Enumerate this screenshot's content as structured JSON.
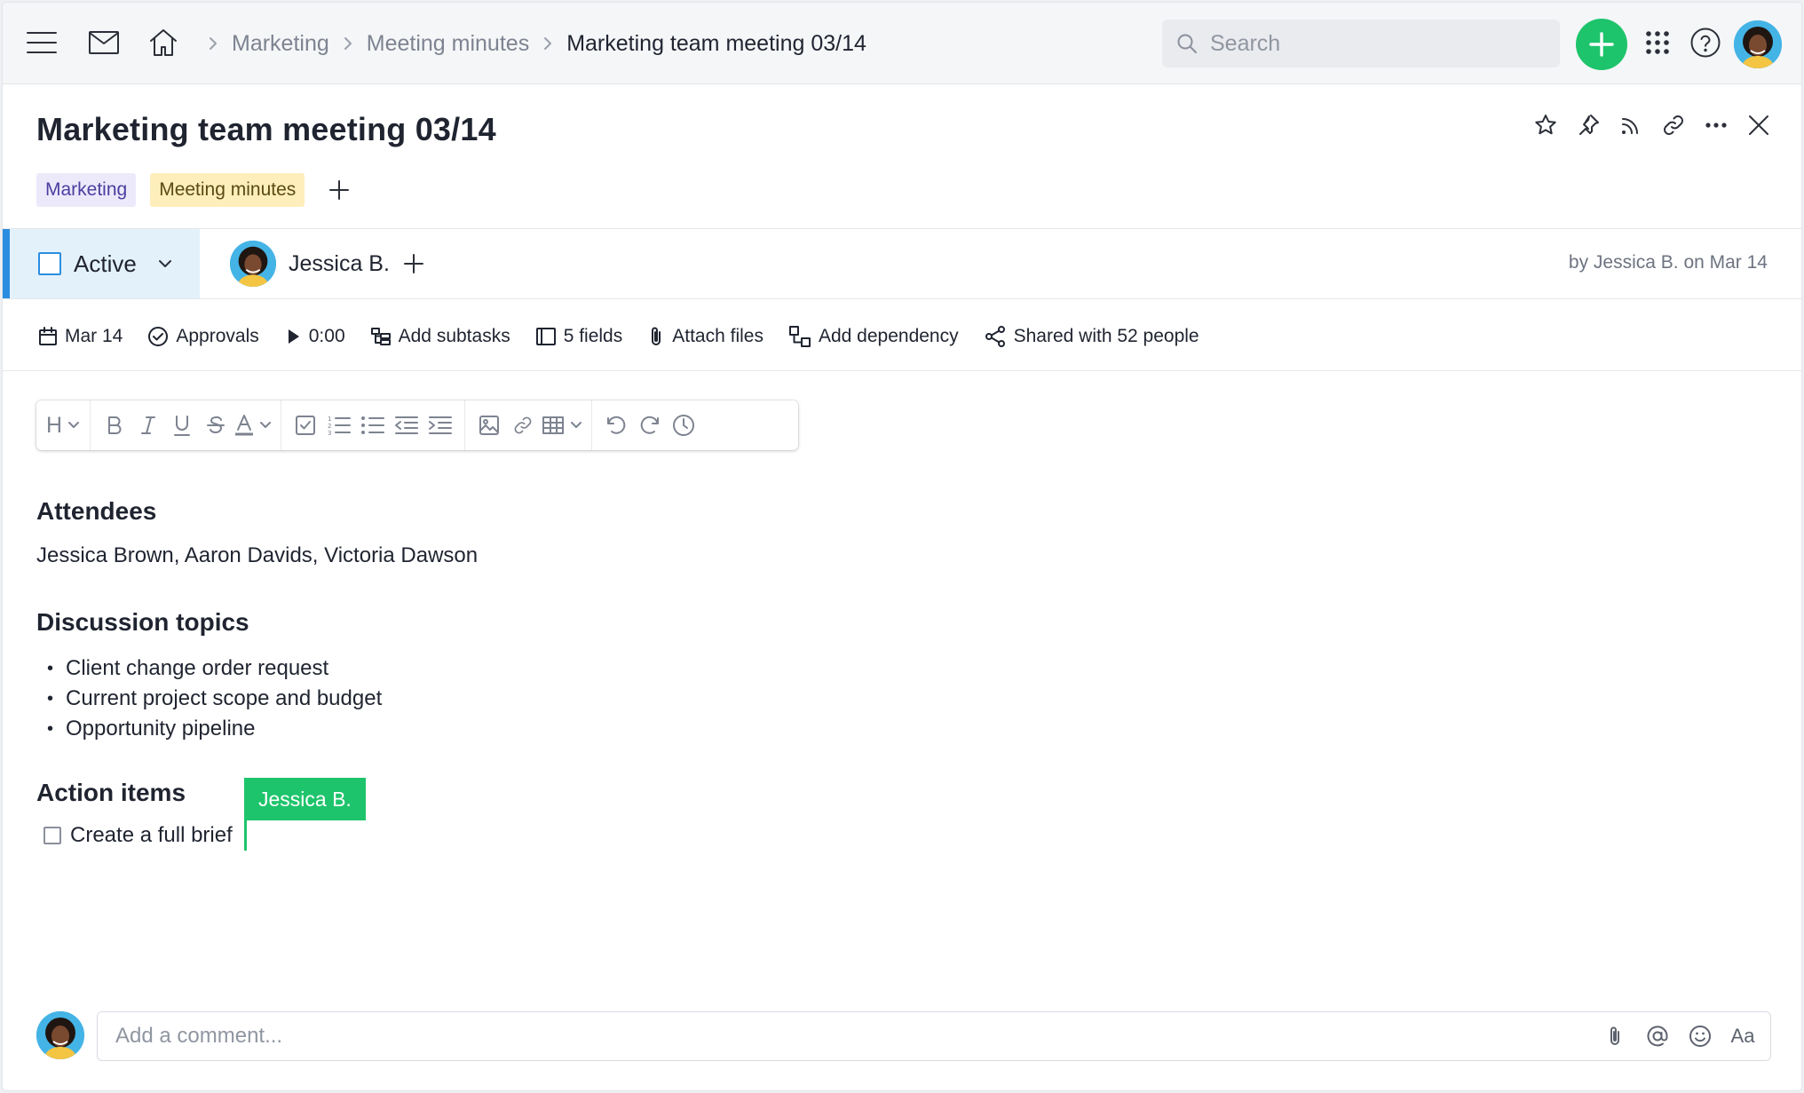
{
  "topbar": {
    "menu_icon": "hamburger-icon",
    "inbox_icon": "mail-icon",
    "home_icon": "home-icon",
    "breadcrumbs": [
      "Marketing",
      "Meeting minutes",
      "Marketing team meeting 03/14"
    ],
    "search_placeholder": "Search",
    "add_button_icon": "plus-icon",
    "apps_icon": "grid-icon",
    "help_icon": "help-icon",
    "brand_color": "#1ec46b"
  },
  "task": {
    "title": "Marketing team meeting 03/14",
    "tags": [
      "Marketing",
      "Meeting minutes"
    ],
    "header_actions": [
      "star-icon",
      "pin-icon",
      "rss-icon",
      "link-icon",
      "more-icon",
      "close-icon"
    ],
    "status": "Active",
    "status_color": "#2b8ee0",
    "assignee": "Jessica B.",
    "byline": "by Jessica B. on Mar 14",
    "meta": {
      "date": "Mar 14",
      "approvals": "Approvals",
      "timer": "0:00",
      "subtasks": "Add subtasks",
      "fields": "5 fields",
      "attach": "Attach files",
      "dependency": "Add dependency",
      "shared": "Shared with 52 people"
    }
  },
  "editor": {
    "toolbar": {
      "heading": "H"
    },
    "sections": {
      "attendees_heading": "Attendees",
      "attendees_text": "Jessica Brown, Aaron Davids, Victoria Dawson",
      "topics_heading": "Discussion topics",
      "topics": [
        "Client change order request",
        "Current project scope and budget",
        "Opportunity pipeline"
      ],
      "actions_heading": "Action items",
      "action_items": [
        "Create a full brief"
      ]
    },
    "collab_cursor": "Jessica B."
  },
  "comment": {
    "placeholder": "Add a comment...",
    "format_label": "Aa"
  }
}
